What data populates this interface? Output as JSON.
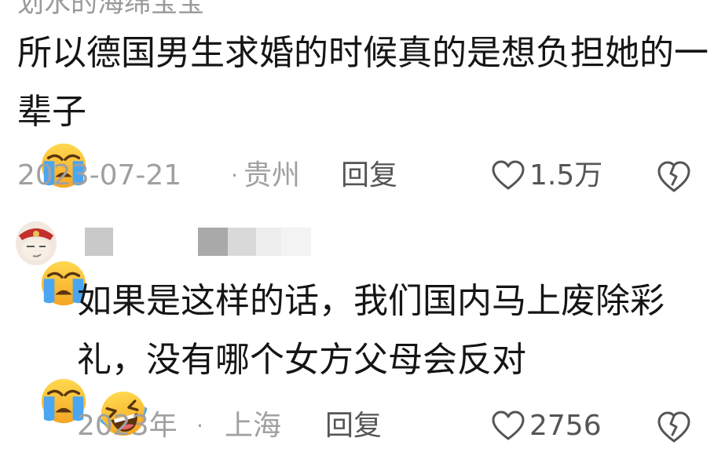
{
  "comment_1": {
    "cropped_username": "划水的海绵宝宝",
    "text": "所以德国男生求婚的时候真的是想负担她的一辈子",
    "emoji": "loudly-crying-face",
    "emoji_count": 3,
    "date": "2023-07-21",
    "separator": "·",
    "location": "贵州",
    "reply_label": "回复",
    "like_count": "1.5万"
  },
  "comment_2": {
    "text_line_1": "如果是这样的话，我们国内马上废除彩",
    "text_line_2": "礼，没有哪个女方父母会反对",
    "emoji": "rolling-on-floor-laughing",
    "date": "2023年",
    "separator": "·",
    "location": "上海",
    "reply_label": "回复",
    "like_count": "2756"
  },
  "colors": {
    "text_primary": "#151515",
    "text_meta": "#a0a0a0",
    "text_action": "#555555",
    "emoji_yellow": "#ffc83a",
    "emoji_tear": "#4aa6f0"
  }
}
